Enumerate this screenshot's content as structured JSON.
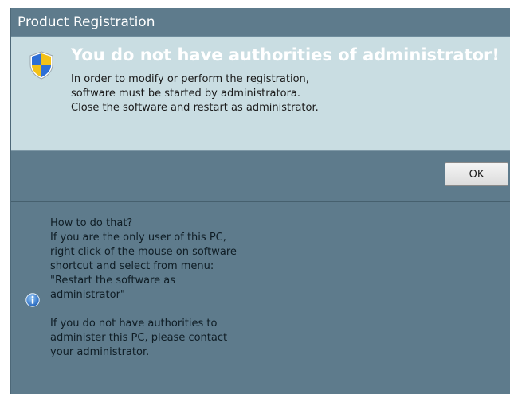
{
  "window": {
    "title": "Product Registration"
  },
  "message": {
    "heading": "You do not have authorities of administrator!",
    "lines": [
      "In order to modify or perform the registration,",
      "software must be started by administratora.",
      "Close the software and restart as administrator."
    ],
    "icon": "shield-icon"
  },
  "buttons": {
    "ok_label": "OK"
  },
  "help": {
    "icon": "info-icon",
    "lines": [
      "How to do that?",
      "If you are the only user of this PC,",
      "right click of the mouse on software",
      "shortcut and select from menu:",
      "\"Restart the software as",
      "administrator\"",
      "",
      "If you do not have authorities to",
      "administer this PC, please contact",
      "your administrator."
    ]
  },
  "colors": {
    "frame": "#5e7b8c",
    "message_panel": "#c9dde2",
    "heading_text": "#ffffff"
  }
}
